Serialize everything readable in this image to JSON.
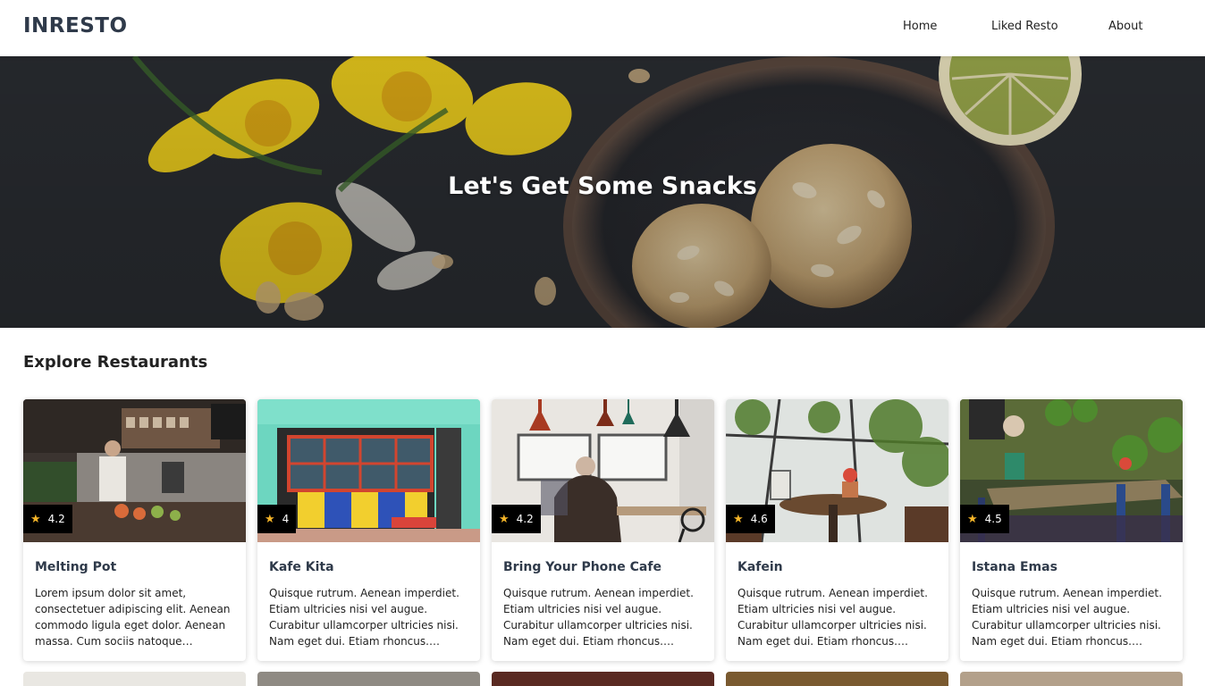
{
  "brand": "INRESTO",
  "nav": [
    {
      "label": "Home"
    },
    {
      "label": "Liked Resto"
    },
    {
      "label": "About"
    }
  ],
  "hero": {
    "title": "Let's Get Some Snacks"
  },
  "explore": {
    "title": "Explore Restaurants"
  },
  "restaurants": [
    {
      "name": "Melting Pot",
      "rating": "4.2",
      "description": "Lorem ipsum dolor sit amet, consectetuer adipiscing elit. Aenean commodo ligula eget dolor. Aenean massa. Cum sociis natoque penatibus et magnis dis parturient montes."
    },
    {
      "name": "Kafe Kita",
      "rating": "4",
      "description": "Quisque rutrum. Aenean imperdiet. Etiam ultricies nisi vel augue. Curabitur ullamcorper ultricies nisi. Nam eget dui. Etiam rhoncus. Maecenas tempus."
    },
    {
      "name": "Bring Your Phone Cafe",
      "rating": "4.2",
      "description": "Quisque rutrum. Aenean imperdiet. Etiam ultricies nisi vel augue. Curabitur ullamcorper ultricies nisi. Nam eget dui. Etiam rhoncus. Maecenas tempus."
    },
    {
      "name": "Kafein",
      "rating": "4.6",
      "description": "Quisque rutrum. Aenean imperdiet. Etiam ultricies nisi vel augue. Curabitur ullamcorper ultricies nisi. Nam eget dui. Etiam rhoncus. Maecenas tempus."
    },
    {
      "name": "Istana Emas",
      "rating": "4.5",
      "description": "Quisque rutrum. Aenean imperdiet. Etiam ultricies nisi vel augue. Curabitur ullamcorper ultricies nisi. Nam eget dui. Etiam rhoncus. Maecenas tempus."
    }
  ],
  "icons": {
    "rating": "star-icon"
  },
  "colors": {
    "star": "#f5b529",
    "brand_text": "#2f3a4a",
    "rating_bg": "#000000"
  }
}
